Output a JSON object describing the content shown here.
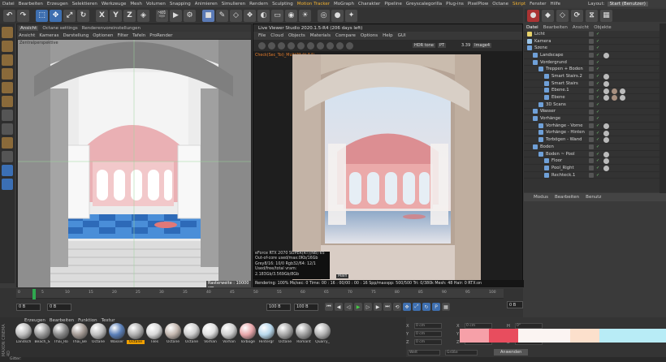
{
  "menu": [
    "Datei",
    "Bearbeiten",
    "Erzeugen",
    "Selektieren",
    "Werkzeuge",
    "Mesh",
    "Volumen",
    "Snapping",
    "Animieren",
    "Simulieren",
    "Rendern",
    "Sculpting",
    "Motion Tracker",
    "MoGraph",
    "Charakter",
    "Pipeline",
    "Greyscalegorilla",
    "Plug-ins",
    "PixelPlow",
    "Octane",
    "Skript",
    "Fenster",
    "Hilfe"
  ],
  "layout_label": "Layout:",
  "layout_value": "Start (Benutzer)",
  "toolbar": {
    "x": "X",
    "y": "Y",
    "z": "Z"
  },
  "viewport": {
    "tabs": [
      "Ansicht",
      "Octane settings",
      "Renderenvoreinstellungen"
    ],
    "menu": [
      "Ansicht",
      "Kameras",
      "Darstellung",
      "Optionen",
      "Filter",
      "Tafeln",
      "ProRender"
    ],
    "perspective_label": "Zentralperspektive",
    "distance_label": "Rasterweite : 10000 cm"
  },
  "liveviewer": {
    "title": "Live Viewer Studio 2020.1.5-R4 (206 days left)",
    "menu": [
      "File",
      "Cloud",
      "Objects",
      "Materials",
      "Compare",
      "Options",
      "Help",
      "GUI"
    ],
    "hdr": "HDR tone",
    "pt": "PT",
    "image": "Image4",
    "zoom": "3.39",
    "check_label": "Check(Sec_Toi)_Multi(Multi 54)",
    "stats": [
      "eForce RTX 2070 SUPER(RT)(NB)    65",
      "Out-of-core used/max:0Kb/16Gb",
      "Grey8/16: 10/0          Rgb32/64: 12/1",
      "Used/free/total vram: 2.183Gb/3.569Gb/8Gb"
    ],
    "main_label": "Main",
    "render_status": "Rendering: 100%  Ms/sec: 0    Time: 00 : 16 : 00/00 : 00 : 16  Spp/maxspp: 500/500    Tri: 0/380k    Mesh: 48    Hair: 0    RTX:on"
  },
  "objects": {
    "tabs": [
      "Datei",
      "Bearbeiten",
      "Ansicht",
      "Objekte"
    ],
    "rows": [
      {
        "label": "Licht",
        "indent": 0
      },
      {
        "label": "Kamera",
        "indent": 0
      },
      {
        "label": "Szene",
        "indent": 0
      },
      {
        "label": "Landscape",
        "indent": 1
      },
      {
        "label": "Vordergrund",
        "indent": 1
      },
      {
        "label": "Treppen + Boden",
        "indent": 2
      },
      {
        "label": "Smart Stairs.2",
        "indent": 3
      },
      {
        "label": "Smart Stairs",
        "indent": 3
      },
      {
        "label": "Ebene.1",
        "indent": 3
      },
      {
        "label": "Ebene",
        "indent": 3
      },
      {
        "label": "3D Scans",
        "indent": 2
      },
      {
        "label": "Wasser",
        "indent": 1
      },
      {
        "label": "Vorhänge",
        "indent": 1
      },
      {
        "label": "Vorhänge - Vorne",
        "indent": 2
      },
      {
        "label": "Vorhänge - Hinten",
        "indent": 2
      },
      {
        "label": "Torbögen - Wand",
        "indent": 2
      },
      {
        "label": "Boden",
        "indent": 1
      },
      {
        "label": "Boden ~ Pool",
        "indent": 2
      },
      {
        "label": "Floor",
        "indent": 3
      },
      {
        "label": "Pool_Right",
        "indent": 3
      },
      {
        "label": "Rechteck.1",
        "indent": 3
      }
    ]
  },
  "attributes": {
    "tabs": [
      "Modus",
      "Bearbeiten",
      "Benutz"
    ]
  },
  "timeline": {
    "ticks": [
      "0",
      "5",
      "10",
      "15",
      "20",
      "25",
      "30",
      "35",
      "40",
      "45",
      "50",
      "55",
      "60",
      "65",
      "70",
      "75",
      "80",
      "85",
      "90",
      "95",
      "100"
    ],
    "frame_start": "0 B",
    "frame_cur": "0 B",
    "frame_end": "100 B",
    "frame_max": "100 B",
    "frame_right": "0 B"
  },
  "materials": {
    "tabs": [
      "Erzeugen",
      "Bearbeiten",
      "Funktion",
      "Textur"
    ],
    "brand": "MAXON CINEMA 4D",
    "items": [
      {
        "label": "Landsch",
        "color": "#bfbfbf"
      },
      {
        "label": "Beach_S",
        "color": "#9a9a9a"
      },
      {
        "label": "Thai_Ro",
        "color": "#8a8a8a"
      },
      {
        "label": "Thai_Be",
        "color": "#a49a94"
      },
      {
        "label": "Octane",
        "color": "#c0c0c0"
      },
      {
        "label": "Wasser",
        "color": "#5a7fb8"
      },
      {
        "label": "Octane",
        "color": "#b0b0b0"
      },
      {
        "label": "Tiles",
        "color": "#d8d8d8"
      },
      {
        "label": "Octane",
        "color": "#c4b8b0"
      },
      {
        "label": "Octane",
        "color": "#cfcfcf"
      },
      {
        "label": "Vorhän",
        "color": "#e0e0e0"
      },
      {
        "label": "Vorhän",
        "color": "#d0d0d0"
      },
      {
        "label": "Torboge",
        "color": "#e8a6aa"
      },
      {
        "label": "Hintergr",
        "color": "#b8d8ec"
      },
      {
        "label": "Octane",
        "color": "#a8a8a8"
      },
      {
        "label": "Romant",
        "color": "#a0a0a0"
      },
      {
        "label": "Quarry_",
        "color": "#b4b4b4"
      }
    ]
  },
  "coords": {
    "rows": [
      [
        "X",
        "0 cm",
        "X",
        "0 cm",
        "H",
        "0°"
      ],
      [
        "Y",
        "0 cm",
        "Y",
        "0 cm",
        "P",
        "0°"
      ],
      [
        "Z",
        "0 cm",
        "Z",
        "0 cm",
        "B",
        "0°"
      ]
    ],
    "mode1": "Welt",
    "mode2": "Größe",
    "apply": "Anwenden"
  },
  "palette": [
    "#f6a0a8",
    "#e84d5e",
    "#fbf4f2",
    "#fce0cc",
    "#b8ecf6"
  ],
  "status": "Gitter:"
}
